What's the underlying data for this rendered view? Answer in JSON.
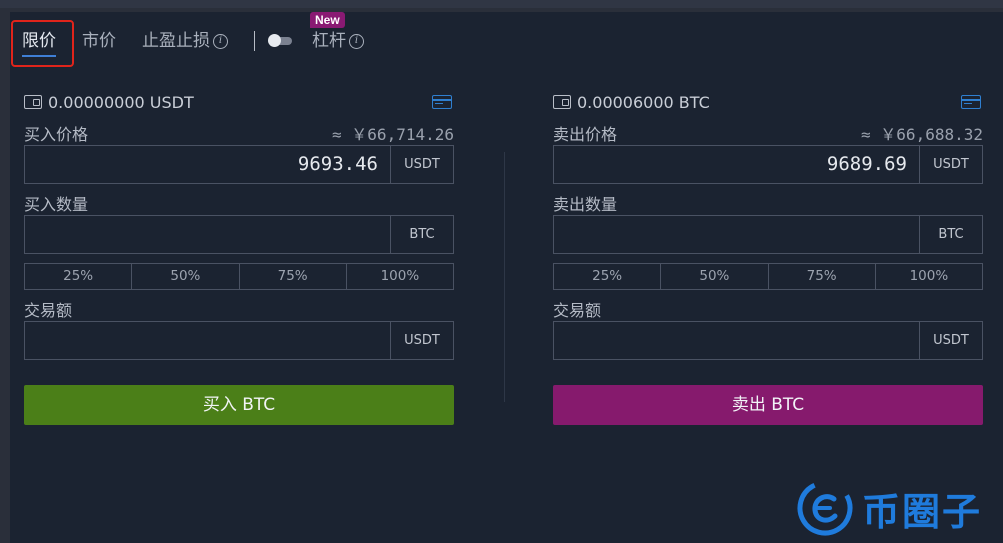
{
  "tabs": [
    {
      "label": "限价",
      "active": true
    },
    {
      "label": "市价",
      "active": false
    },
    {
      "label": "止盈止损",
      "active": false,
      "info_icon": "info-icon"
    }
  ],
  "leverage": {
    "label": "杠杆",
    "badge": "New",
    "info_icon": "info-icon"
  },
  "buy": {
    "balance": "0.00000000 USDT",
    "price_label": "买入价格",
    "price_approx": "≈ ￥66,714.26",
    "price_value": "9693.46",
    "price_unit": "USDT",
    "amount_label": "买入数量",
    "amount_value": "",
    "amount_unit": "BTC",
    "percents": [
      "25%",
      "50%",
      "75%",
      "100%"
    ],
    "total_label": "交易额",
    "total_value": "",
    "total_unit": "USDT",
    "button": "买入 BTC"
  },
  "sell": {
    "balance": "0.00006000 BTC",
    "price_label": "卖出价格",
    "price_approx": "≈ ￥66,688.32",
    "price_value": "9689.69",
    "price_unit": "USDT",
    "amount_label": "卖出数量",
    "amount_value": "",
    "amount_unit": "BTC",
    "percents": [
      "25%",
      "50%",
      "75%",
      "100%"
    ],
    "total_label": "交易额",
    "total_value": "",
    "total_unit": "USDT",
    "button": "卖出 BTC"
  },
  "watermark": {
    "text": "币圈子"
  },
  "colors": {
    "background": "#1b2331",
    "buy_button": "#4b7f18",
    "sell_button": "#861a6d",
    "accent_blue": "#2f7fd0",
    "highlight_red": "#e0241b",
    "badge": "#8a1a73"
  }
}
